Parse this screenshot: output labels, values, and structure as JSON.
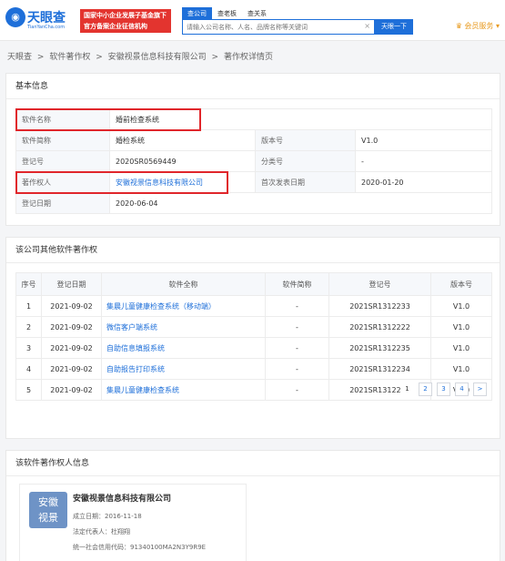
{
  "header": {
    "logo_text": "天眼查",
    "logo_sub": "TianYanCha.com",
    "promo_line1": "国家中小企业发展子基金旗下",
    "promo_line2": "官方备案企业征信机构",
    "tabs": [
      "查公司",
      "查老板",
      "查关系"
    ],
    "search_placeholder": "请输入公司名称、人名、品牌名称等关键词",
    "search_button": "天眼一下",
    "member": "会员服务"
  },
  "breadcrumb": [
    "天眼查",
    ">",
    "软件著作权",
    ">",
    "安徽视景信息科技有限公司",
    ">",
    "著作权详情页"
  ],
  "basic": {
    "title": "基本信息",
    "software_name_label": "软件名称",
    "software_name": "婚前检查系统",
    "short_name_label": "软件简称",
    "short_name": "婚检系统",
    "version_label": "版本号",
    "version": "V1.0",
    "reg_no_label": "登记号",
    "reg_no": "2020SR0569449",
    "category_label": "分类号",
    "category": "-",
    "owner_label": "著作权人",
    "owner": "安徽视景信息科技有限公司",
    "first_pub_label": "首次发表日期",
    "first_pub": "2020-01-20",
    "reg_date_label": "登记日期",
    "reg_date": "2020-06-04"
  },
  "others": {
    "title": "该公司其他软件著作权",
    "headers": [
      "序号",
      "登记日期",
      "软件全称",
      "软件简称",
      "登记号",
      "版本号"
    ],
    "rows": [
      {
        "no": "1",
        "date": "2021-09-02",
        "name": "集晨儿童健康检查系统（移动端）",
        "short": "-",
        "reg": "2021SR1312233",
        "ver": "V1.0"
      },
      {
        "no": "2",
        "date": "2021-09-02",
        "name": "微信客户端系统",
        "short": "-",
        "reg": "2021SR1312222",
        "ver": "V1.0"
      },
      {
        "no": "3",
        "date": "2021-09-02",
        "name": "自助信息填报系统",
        "short": "-",
        "reg": "2021SR1312235",
        "ver": "V1.0"
      },
      {
        "no": "4",
        "date": "2021-09-02",
        "name": "自助报告打印系统",
        "short": "-",
        "reg": "2021SR1312234",
        "ver": "V1.0"
      },
      {
        "no": "5",
        "date": "2021-09-02",
        "name": "集晨儿童健康检查系统",
        "short": "-",
        "reg": "2021SR1312223",
        "ver": "V1.0"
      }
    ],
    "pages": [
      "1",
      "2",
      "3",
      "4",
      ">"
    ]
  },
  "owner_info": {
    "title": "该软件著作权人信息",
    "logo_line1": "安徽",
    "logo_line2": "视景",
    "name": "安徽视景信息科技有限公司",
    "established": "成立日期：2016-11-18",
    "legal_rep": "法定代表人：杜翔翔",
    "credit_code": "统一社会信用代码：91340100MA2N3Y9R9E"
  },
  "colors": {
    "accent": "#1e6fd9",
    "highlight": "#e0262b",
    "promo": "#e3342f"
  }
}
